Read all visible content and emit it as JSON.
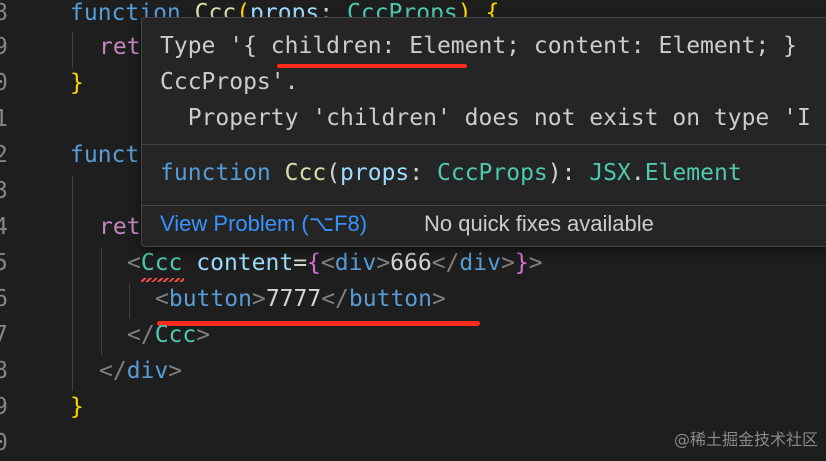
{
  "line_numbers": [
    "8",
    "9",
    "0",
    "1",
    "2",
    "3",
    "4",
    "5",
    "6",
    "7",
    "8",
    "9",
    "0"
  ],
  "code": {
    "l1": {
      "kw": "function",
      "fn": "Ccc",
      "p1": "(",
      "param": "props",
      "colon": ": ",
      "type": "CccProps",
      "p2": ")",
      "brace": " {"
    },
    "l2": {
      "kw": "ret"
    },
    "l3": {
      "brace": "}"
    },
    "l5": {
      "kw": "funct"
    },
    "l7": {
      "kw": "ret"
    },
    "l8": {
      "lt": "<",
      "comp": "Ccc",
      "attr": " content",
      "eq": "=",
      "b1": "{",
      "lt2": "<",
      "div": "div",
      "gt2": ">",
      "txt": "666",
      "lt3": "</",
      "div2": "div",
      "gt3": ">",
      "b2": "}",
      "gt": ">"
    },
    "l9": {
      "lt": "<",
      "tag": "button",
      "gt": ">",
      "txt": "7777",
      "lt2": "</",
      "tag2": "button",
      "gt2": ">"
    },
    "l10": {
      "lt": "</",
      "comp": "Ccc",
      "gt": ">"
    },
    "l11": {
      "lt": "</",
      "tag": "div",
      "gt": ">"
    },
    "l12": {
      "brace": "}"
    }
  },
  "hover": {
    "line1": "Type '{ children: Element; content: Element; }",
    "line2": "CccProps'.",
    "line3": "  Property 'children' does not exist on type 'I",
    "sig": {
      "kw": "function",
      "fn": "Ccc",
      "p1": "(",
      "param": "props",
      "colon": ": ",
      "type": "CccProps",
      "p2": "): ",
      "ns": "JSX",
      "dot": ".",
      "ret": "Element"
    },
    "view_problem": "View Problem (⌥F8)",
    "no_fixes": "No quick fixes available"
  },
  "watermark": "@稀土掘金技术社区"
}
